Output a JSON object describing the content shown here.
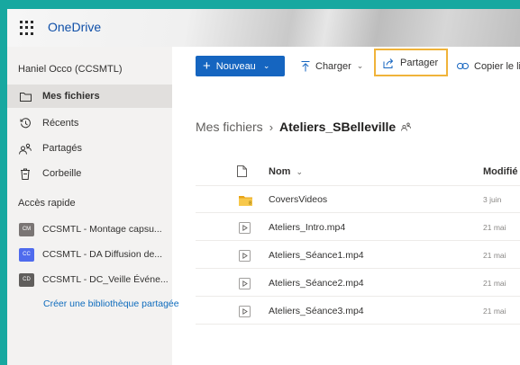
{
  "app": {
    "name": "OneDrive"
  },
  "colors": {
    "accent": "#1565c0",
    "frame_bg": "#17a8a0",
    "highlight": "#f0b33a"
  },
  "nav": {
    "user": "Haniel Occo (CCSMTL)",
    "items": [
      {
        "label": "Mes fichiers",
        "icon": "folder-icon",
        "active": true
      },
      {
        "label": "Récents",
        "icon": "clock-icon",
        "active": false
      },
      {
        "label": "Partagés",
        "icon": "people-icon",
        "active": false
      },
      {
        "label": "Corbeille",
        "icon": "trash-icon",
        "active": false
      }
    ],
    "quick_access_title": "Accès rapide",
    "libraries": [
      {
        "badge": "CM",
        "color": "#7a7574",
        "label": "CCSMTL - Montage capsu..."
      },
      {
        "badge": "CC",
        "color": "#4f6bed",
        "label": "CCSMTL - DA Diffusion de..."
      },
      {
        "badge": "CD",
        "color": "#605e5c",
        "label": "CCSMTL - DC_Veille Événe..."
      }
    ],
    "create_library": "Créer une bibliothèque partagée"
  },
  "toolbar": {
    "new_label": "Nouveau",
    "upload_label": "Charger",
    "share_label": "Partager",
    "copy_link_label": "Copier le lien"
  },
  "breadcrumb": {
    "root": "Mes fichiers",
    "current": "Ateliers_SBelleville"
  },
  "list": {
    "col_name": "Nom",
    "col_modified": "Modifié",
    "rows": [
      {
        "name": "CoversVideos",
        "type": "folder",
        "modified": "3 juin"
      },
      {
        "name": "Ateliers_Intro.mp4",
        "type": "video",
        "modified": "21 mai"
      },
      {
        "name": "Ateliers_Séance1.mp4",
        "type": "video",
        "modified": "21 mai"
      },
      {
        "name": "Ateliers_Séance2.mp4",
        "type": "video",
        "modified": "21 mai"
      },
      {
        "name": "Ateliers_Séance3.mp4",
        "type": "video",
        "modified": "21 mai"
      }
    ]
  }
}
